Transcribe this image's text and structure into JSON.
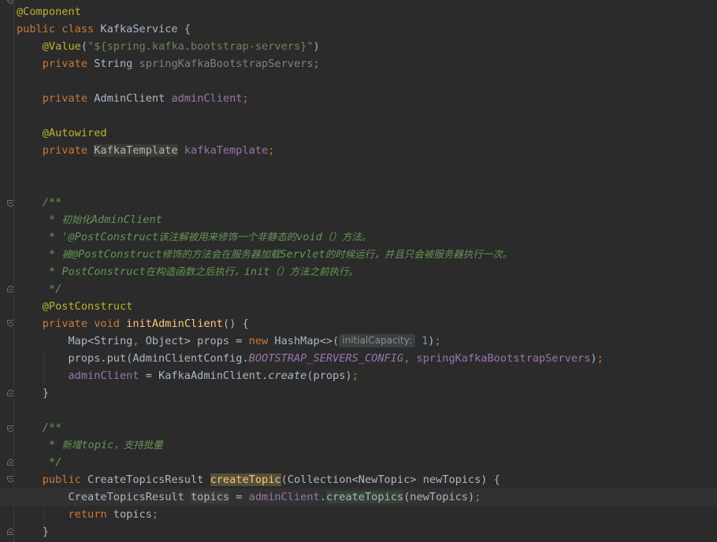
{
  "code": {
    "l1": "@Component",
    "l2_kw1": "public",
    "l2_kw2": "class",
    "l2_name": "KafkaService {",
    "l3_ann": "@Value",
    "l3_open": "(",
    "l3_str": "\"${spring.kafka.bootstrap-servers}\"",
    "l3_close": ")",
    "l4_kw": "private",
    "l4_type": "String",
    "l4_field": "springKafkaBootstrapServers",
    "semicolon": ";",
    "l6_kw": "private",
    "l6_type": "AdminClient",
    "l6_field": "adminClient",
    "l8_ann": "@Autowired",
    "l9_kw": "private",
    "l9_type": "KafkaTemplate",
    "l9_field": "kafkaTemplate",
    "c1_open": "/**",
    "c1_l1_star": " * ",
    "c1_l1_cjk": "初始化",
    "c1_l1_code": "AdminClient",
    "c1_l2_star": " * '",
    "c1_l2_code1": "@PostConstruct",
    "c1_l2_cjk1": "该注解被用来修饰一个非静态的",
    "c1_l2_code2": "void",
    "c1_l2_cjk2": "（）方法。",
    "c1_l3_star": " * ",
    "c1_l3_cjk1": "被",
    "c1_l3_code1": "@PostConstruct",
    "c1_l3_cjk2": "修饰的方法会在服务器加载",
    "c1_l3_code2": "Servlet",
    "c1_l3_cjk3": "的时候运行，并且只会被服务器执行一次。",
    "c1_l4_star": " * ",
    "c1_l4_code1": "PostConstruct",
    "c1_l4_cjk1": "在构造函数之后执行，",
    "c1_l4_code2": "init",
    "c1_l4_cjk2": "（）方法之前执行。",
    "c_close": " */",
    "m1_ann": "@PostConstruct",
    "m1_kw1": "private",
    "m1_kw2": "void",
    "m1_name": "initAdminClient",
    "m1_rest": "() {",
    "b1_a": "Map<String",
    "b1_comma": ",",
    "b1_b": " Object> props = ",
    "b1_new": "new",
    "b1_c": " HashMap<>(",
    "b1_hint": "initialCapacity:",
    "b1_num": "1",
    "b1_d": ")",
    "b2_a": "props.put(AdminClientConfig.",
    "b2_const": "BOOTSTRAP_SERVERS_CONFIG",
    "b2_comma": ",",
    "b2_field": "springKafkaBootstrapServers",
    "b2_end": ")",
    "b3_field": "adminClient",
    "b3_a": " = KafkaAdminClient.",
    "b3_method": "create",
    "b3_b": "(props)",
    "close_brace": "}",
    "c2_open": "/**",
    "c2_star": " * ",
    "c2_cjk1": "新增",
    "c2_code": "topic",
    "c2_cjk2": "，支持批量",
    "m2_kw": "public",
    "m2_type": "CreateTopicsResult",
    "m2_name": "createTopic",
    "m2_rest": "(Collection<NewTopic> newTopics) {",
    "b4_type": "CreateTopicsResult",
    "b4_var": "topics",
    "b4_eq": " = ",
    "b4_field": "adminClient",
    "b4_dot": ".",
    "b4_call": "createTopics",
    "b4_args": "(newTopics)",
    "b5_kw": "return",
    "b5_rest": " topics",
    "icons": [
      "fold-icon",
      "intention-bulb-icon"
    ]
  }
}
